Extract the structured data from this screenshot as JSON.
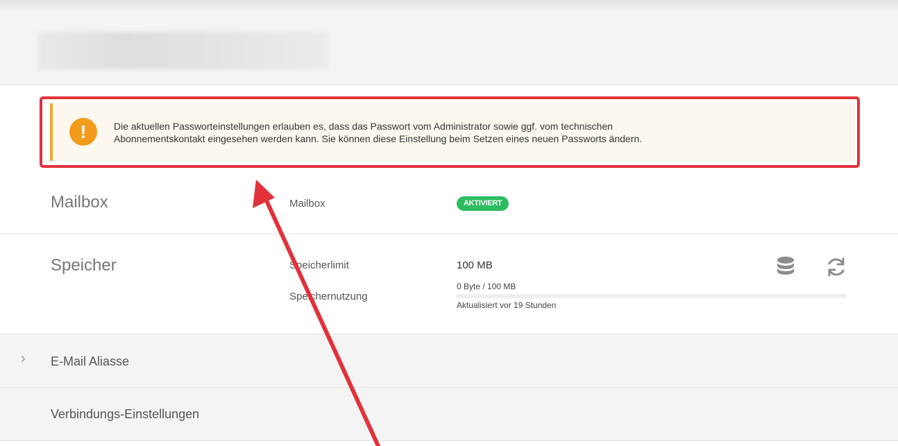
{
  "alert": {
    "line1": "Die aktuellen Passworteinstellungen erlauben es, dass das Passwort vom Administrator sowie ggf. vom technischen",
    "line2": "Abonnementskontakt eingesehen werden kann. Sie können diese Einstellung beim Setzen eines neuen Passworts ändern.",
    "icon": "warning-exclamation-icon",
    "accent": "#f1a62a",
    "highlight_color": "#e1323a"
  },
  "mailbox": {
    "title": "Mailbox",
    "label": "Mailbox",
    "status": "AKTIVIERT",
    "status_color": "#2dbd5f"
  },
  "storage": {
    "title": "Speicher",
    "limit_label": "Speicherlimit",
    "limit_value": "100 MB",
    "usage_label": "Speichernutzung",
    "usage_value": "0 Byte / 100 MB",
    "usage_fraction": 0,
    "updated": "Aktualisiert vor 19 Stunden",
    "icons": [
      "database-icon",
      "refresh-icon"
    ]
  },
  "sections": {
    "aliases": "E-Mail Aliasse",
    "connection": "Verbindungs-Einstellungen"
  }
}
